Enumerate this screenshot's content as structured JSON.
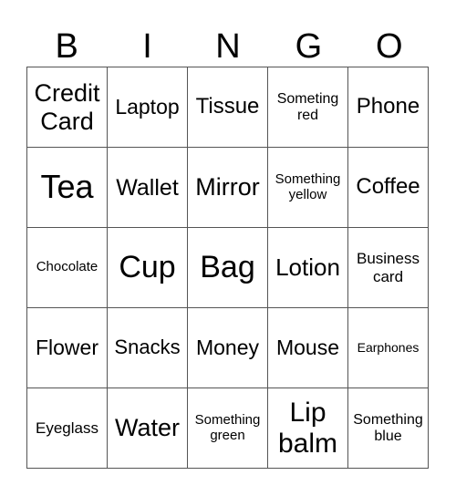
{
  "header": [
    "B",
    "I",
    "N",
    "G",
    "O"
  ],
  "cells": [
    [
      {
        "t": "Credit Card",
        "s": 27
      },
      {
        "t": "Laptop",
        "s": 23
      },
      {
        "t": "Tissue",
        "s": 24
      },
      {
        "t": "Someting red",
        "s": 16
      },
      {
        "t": "Phone",
        "s": 24
      }
    ],
    [
      {
        "t": "Tea",
        "s": 36
      },
      {
        "t": "Wallet",
        "s": 25
      },
      {
        "t": "Mirror",
        "s": 27
      },
      {
        "t": "Something yellow",
        "s": 15
      },
      {
        "t": "Coffee",
        "s": 24
      }
    ],
    [
      {
        "t": "Chocolate",
        "s": 15
      },
      {
        "t": "Cup",
        "s": 34
      },
      {
        "t": "Bag",
        "s": 34
      },
      {
        "t": "Lotion",
        "s": 26
      },
      {
        "t": "Business card",
        "s": 17
      }
    ],
    [
      {
        "t": "Flower",
        "s": 23
      },
      {
        "t": "Snacks",
        "s": 22
      },
      {
        "t": "Money",
        "s": 23
      },
      {
        "t": "Mouse",
        "s": 23
      },
      {
        "t": "Earphones",
        "s": 14
      }
    ],
    [
      {
        "t": "Eyeglass",
        "s": 17
      },
      {
        "t": "Water",
        "s": 27
      },
      {
        "t": "Something green",
        "s": 15
      },
      {
        "t": "Lip balm",
        "s": 30
      },
      {
        "t": "Something blue",
        "s": 16
      }
    ]
  ]
}
